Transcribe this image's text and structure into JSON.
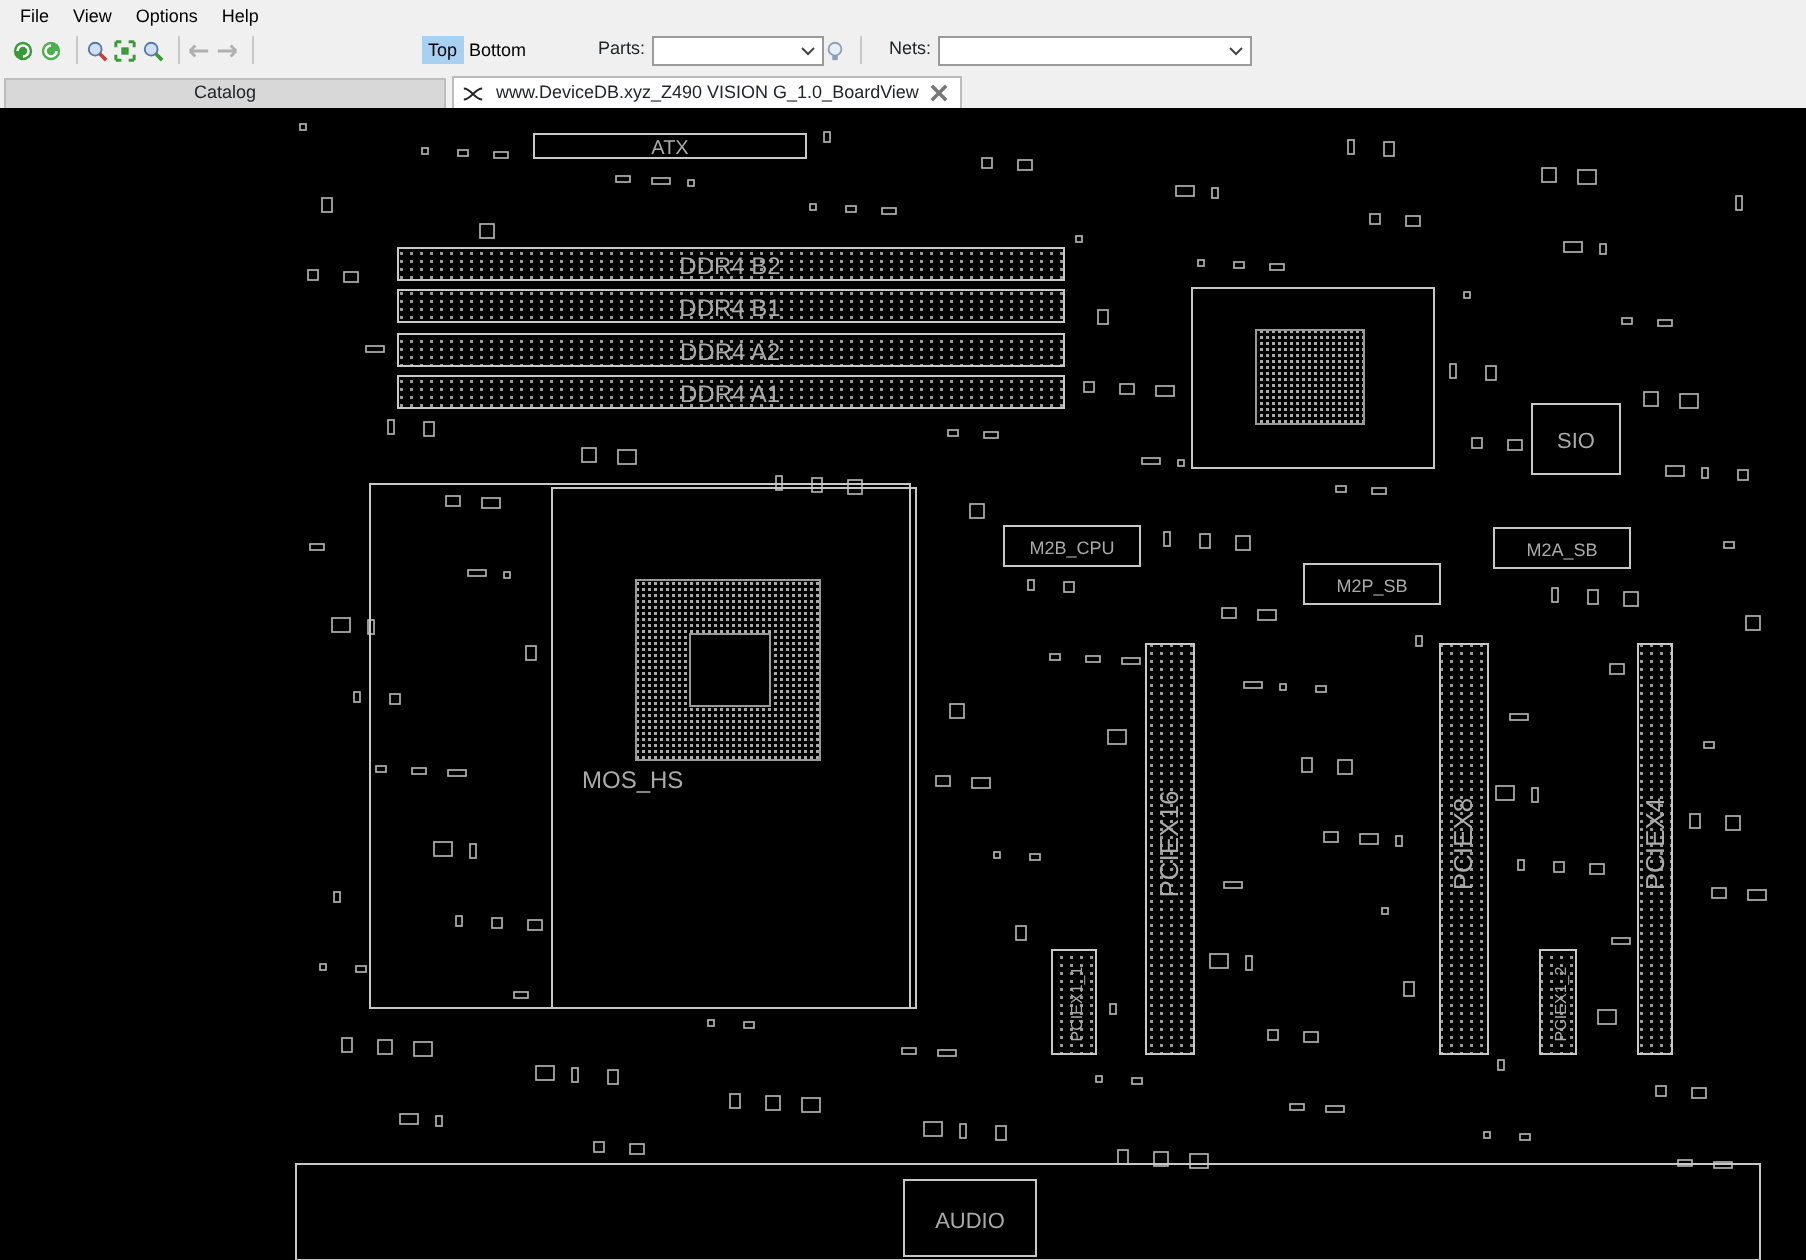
{
  "menu": [
    "File",
    "View",
    "Options",
    "Help"
  ],
  "toolbar": {
    "side": [
      {
        "label": "Top",
        "selected": true
      },
      {
        "label": "Bottom",
        "selected": false
      }
    ],
    "parts": {
      "label": "Parts:"
    },
    "nets": {
      "label": "Nets:"
    }
  },
  "tabs": [
    {
      "label": "Catalog",
      "selected": false
    },
    {
      "label": "www.DeviceDB.xyz_Z490 VISION G_1.0_BoardView",
      "selected": true
    }
  ],
  "board": {
    "components": [
      {
        "kind": "header",
        "label": "ATX"
      },
      {
        "kind": "memory",
        "label": "DDR4  B2"
      },
      {
        "kind": "memory",
        "label": "DDR4  B1"
      },
      {
        "kind": "memory",
        "label": "DDR4  A2"
      },
      {
        "kind": "memory",
        "label": "DDR4  A1"
      },
      {
        "kind": "heatsink",
        "label": "MOS_HS"
      },
      {
        "kind": "chip",
        "label": "SIO"
      },
      {
        "kind": "header",
        "label": "M2B_CPU"
      },
      {
        "kind": "header",
        "label": "M2P_SB"
      },
      {
        "kind": "header",
        "label": "M2A_SB"
      },
      {
        "kind": "pcie",
        "label": "PCIEX16"
      },
      {
        "kind": "pcie",
        "label": "PCIEX8"
      },
      {
        "kind": "pcie",
        "label": "PCIEX4"
      },
      {
        "kind": "pcie",
        "label": "PCIEX1_1"
      },
      {
        "kind": "pcie",
        "label": "PCIEX1_2"
      },
      {
        "kind": "header",
        "label": "AUDIO"
      }
    ]
  }
}
